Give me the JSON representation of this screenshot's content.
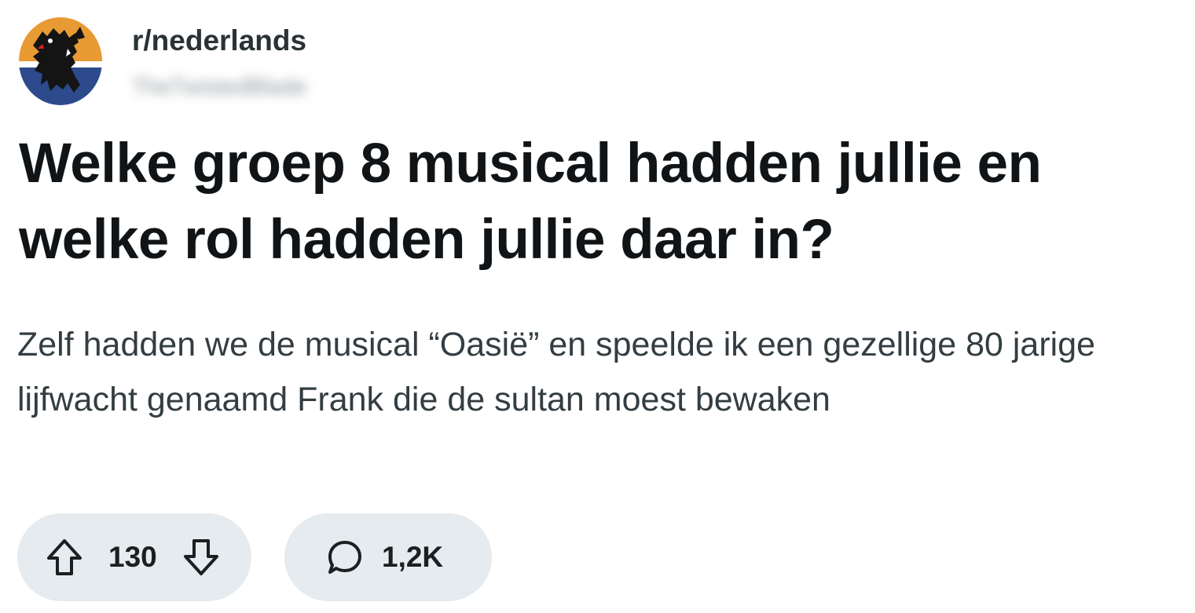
{
  "post": {
    "subreddit": "r/nederlands",
    "author": "TheTwistedBlade",
    "title": "Welke groep 8 musical hadden jullie en welke rol hadden jullie daar in?",
    "body": "Zelf hadden we de musical “Oasië” en speelde ik een gezellige 80 jarige lijfwacht genaamd Frank die de sultan moest bewaken",
    "avatar_icon": "flemish-lion-icon"
  },
  "actions": {
    "vote_count": "130",
    "comment_count": "1,2K",
    "upvote_icon": "arrow-up-icon",
    "downvote_icon": "arrow-down-icon",
    "comment_icon": "speech-bubble-icon"
  },
  "colors": {
    "avatar_top": "#e89a33",
    "avatar_bottom": "#2c4a8c",
    "pill_bg": "#e5ebee",
    "title_text": "#111416",
    "body_text": "#333d42"
  }
}
